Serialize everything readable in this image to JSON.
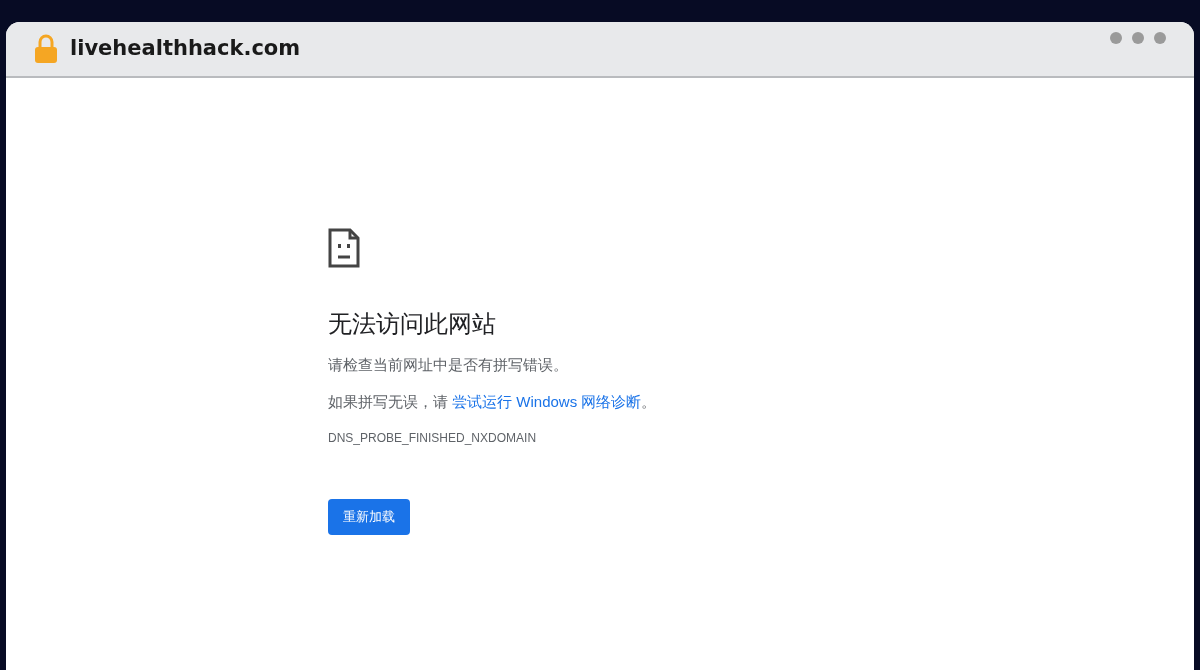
{
  "address_bar": {
    "url": "livehealthhack.com"
  },
  "error_page": {
    "title": "无法访问此网站",
    "hint": "请检查当前网址中是否有拼写错误。",
    "suggestion": {
      "text": "如果拼写无误，请",
      "link": "尝试运行 Windows 网络诊断",
      "end": "。"
    },
    "error_code": "DNS_PROBE_FINISHED_NXDOMAIN",
    "reload_button": "重新加载"
  }
}
